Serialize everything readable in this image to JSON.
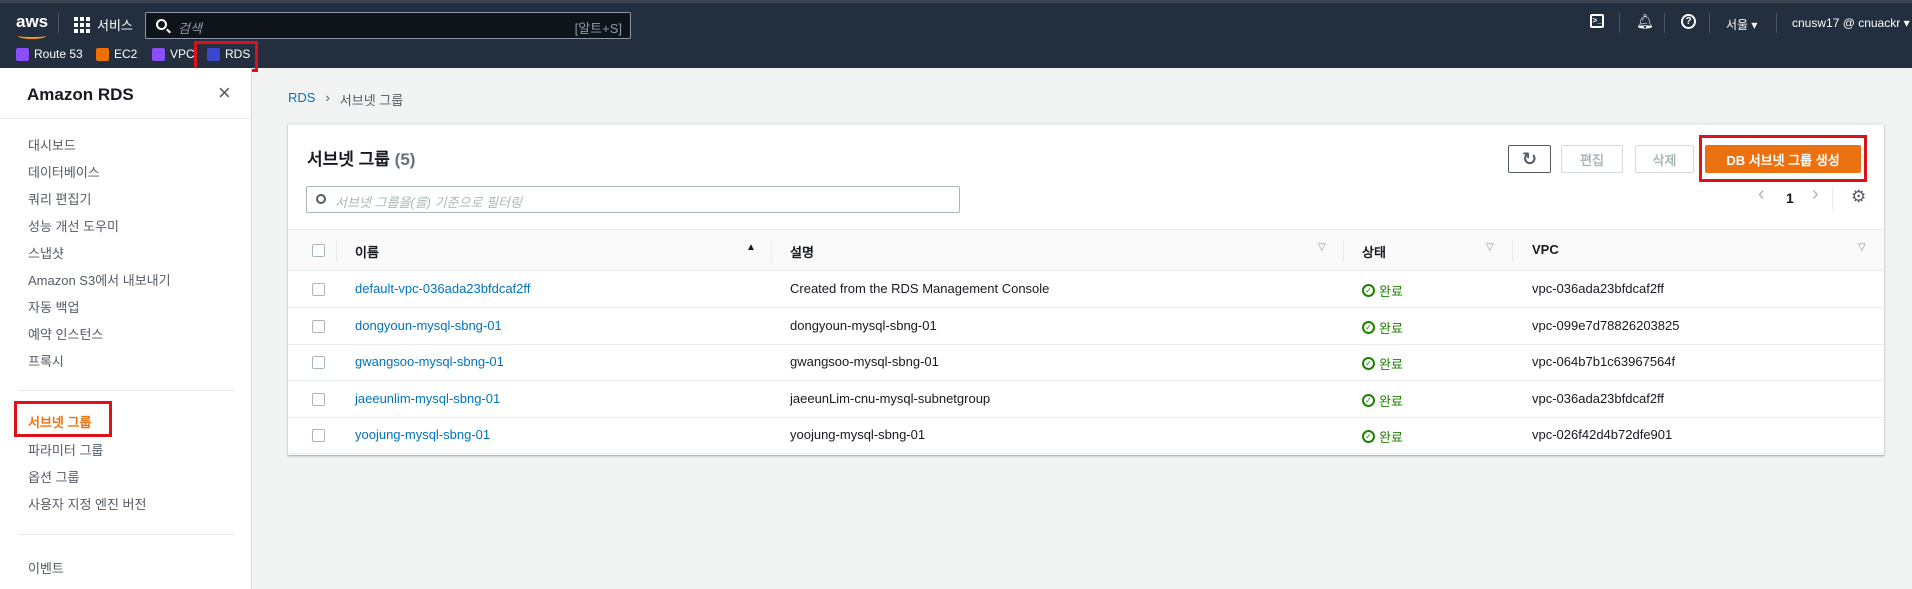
{
  "topnav": {
    "logo": "aws",
    "services": "서비스",
    "search_placeholder": "검색",
    "search_shortcut": "[알트+S]",
    "region": "서울 ▾",
    "account": "cnusw17 @ cnuackr ▾",
    "favorites": [
      {
        "label": "Route 53",
        "color": "#8c4fff"
      },
      {
        "label": "EC2",
        "color": "#ed7100"
      },
      {
        "label": "VPC",
        "color": "#8c4fff"
      },
      {
        "label": "RDS",
        "color": "#3b48cc"
      }
    ]
  },
  "sidebar": {
    "title": "Amazon RDS",
    "close": "×",
    "items": [
      "대시보드",
      "데이터베이스",
      "쿼리 편집기",
      "성능 개선 도우미",
      "스냅샷",
      "Amazon S3에서 내보내기",
      "자동 백업",
      "예약 인스턴스",
      "프록시"
    ],
    "items2": [
      "서브넷 그룹",
      "파라미터 그룹",
      "옵션 그룹",
      "사용자 지정 엔진 버전"
    ],
    "items3": [
      "이벤트"
    ]
  },
  "breadcrumb": {
    "root": "RDS",
    "sep": "›",
    "current": "서브넷 그룹"
  },
  "panel": {
    "title": "서브넷 그룹",
    "count": "(5)",
    "refresh": "↻",
    "edit": "편집",
    "delete": "삭제",
    "create": "DB 서브넷 그룹 생성",
    "filter_placeholder": "서브넷 그룹을(를) 기준으로 필터링",
    "page": "1",
    "prev": "‹",
    "next": "›",
    "settings": "⚙"
  },
  "table": {
    "headers": {
      "name": "이름",
      "description": "설명",
      "status": "상태",
      "vpc": "VPC"
    },
    "rows": [
      {
        "name": "default-vpc-036ada23bfdcaf2ff",
        "description": "Created from the RDS Management Console",
        "status": "완료",
        "vpc": "vpc-036ada23bfdcaf2ff"
      },
      {
        "name": "dongyoun-mysql-sbng-01",
        "description": "dongyoun-mysql-sbng-01",
        "status": "완료",
        "vpc": "vpc-099e7d78826203825"
      },
      {
        "name": "gwangsoo-mysql-sbng-01",
        "description": "gwangsoo-mysql-sbng-01",
        "status": "완료",
        "vpc": "vpc-064b7b1c63967564f"
      },
      {
        "name": "jaeeunlim-mysql-sbng-01",
        "description": "jaeeunLim-cnu-mysql-subnetgroup",
        "status": "완료",
        "vpc": "vpc-036ada23bfdcaf2ff"
      },
      {
        "name": "yoojung-mysql-sbng-01",
        "description": "yoojung-mysql-sbng-01",
        "status": "완료",
        "vpc": "vpc-026f42d4b72dfe901"
      }
    ]
  }
}
